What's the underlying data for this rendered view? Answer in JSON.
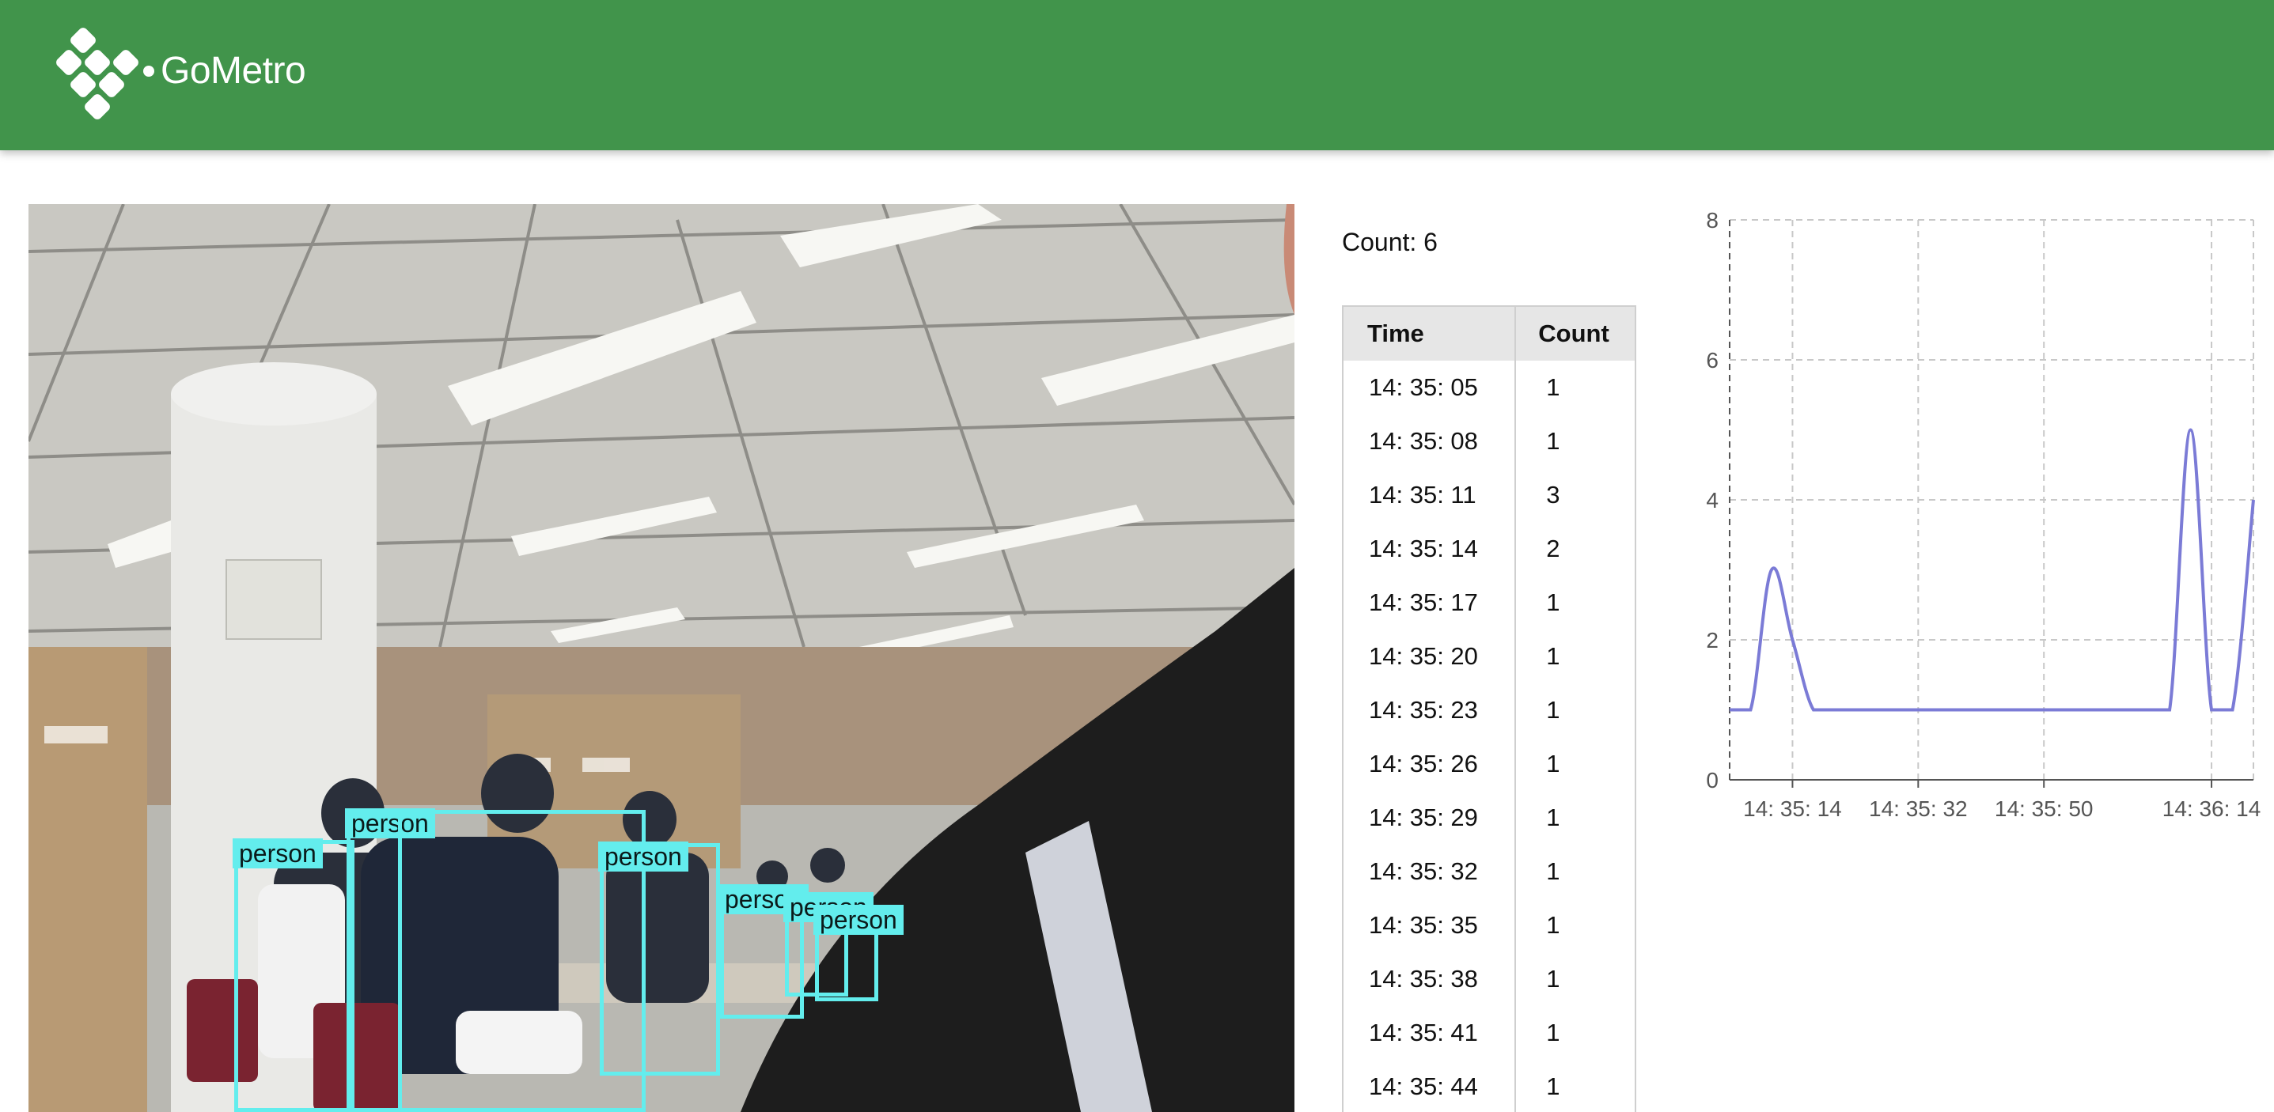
{
  "header": {
    "brand": "GoMetro",
    "logo_icon": "gometro-logo-icon",
    "background": "#41944b"
  },
  "feed": {
    "detections": [
      {
        "label": "person"
      },
      {
        "label": "person"
      },
      {
        "label": "person"
      },
      {
        "label": "person"
      },
      {
        "label": "person"
      },
      {
        "label": "person"
      }
    ],
    "box_color": "#63eded"
  },
  "count": {
    "text": "Count: 6"
  },
  "table": {
    "headers": [
      "Time",
      "Count"
    ],
    "rows": [
      [
        "14: 35: 05",
        "1"
      ],
      [
        "14: 35: 08",
        "1"
      ],
      [
        "14: 35: 11",
        "3"
      ],
      [
        "14: 35: 14",
        "2"
      ],
      [
        "14: 35: 17",
        "1"
      ],
      [
        "14: 35: 20",
        "1"
      ],
      [
        "14: 35: 23",
        "1"
      ],
      [
        "14: 35: 26",
        "1"
      ],
      [
        "14: 35: 29",
        "1"
      ],
      [
        "14: 35: 32",
        "1"
      ],
      [
        "14: 35: 35",
        "1"
      ],
      [
        "14: 35: 38",
        "1"
      ],
      [
        "14: 35: 41",
        "1"
      ],
      [
        "14: 35: 44",
        "1"
      ]
    ]
  },
  "chart_data": {
    "type": "line",
    "x": [
      "14:35:05",
      "14:35:08",
      "14:35:11",
      "14:35:14",
      "14:35:17",
      "14:35:20",
      "14:35:23",
      "14:35:26",
      "14:35:29",
      "14:35:32",
      "14:35:35",
      "14:35:38",
      "14:35:41",
      "14:35:44",
      "14:35:47",
      "14:35:50",
      "14:35:53",
      "14:35:56",
      "14:35:59",
      "14:36:02",
      "14:36:05",
      "14:36:08",
      "14:36:11",
      "14:36:14",
      "14:36:17",
      "14:36:20"
    ],
    "series": [
      {
        "values": [
          1,
          1,
          3,
          2,
          1,
          1,
          1,
          1,
          1,
          1,
          1,
          1,
          1,
          1,
          1,
          1,
          1,
          1,
          1,
          1,
          1,
          1,
          5,
          1,
          1,
          4
        ],
        "color": "#7b7bd6"
      }
    ],
    "ylim": [
      0,
      8
    ],
    "yticks": [
      0,
      2,
      4,
      6,
      8
    ],
    "xticks": [
      "14: 35: 14",
      "14: 35: 32",
      "14: 35: 50",
      "14: 36: 14"
    ],
    "grid": true,
    "title": "",
    "xlabel": "",
    "ylabel": ""
  }
}
